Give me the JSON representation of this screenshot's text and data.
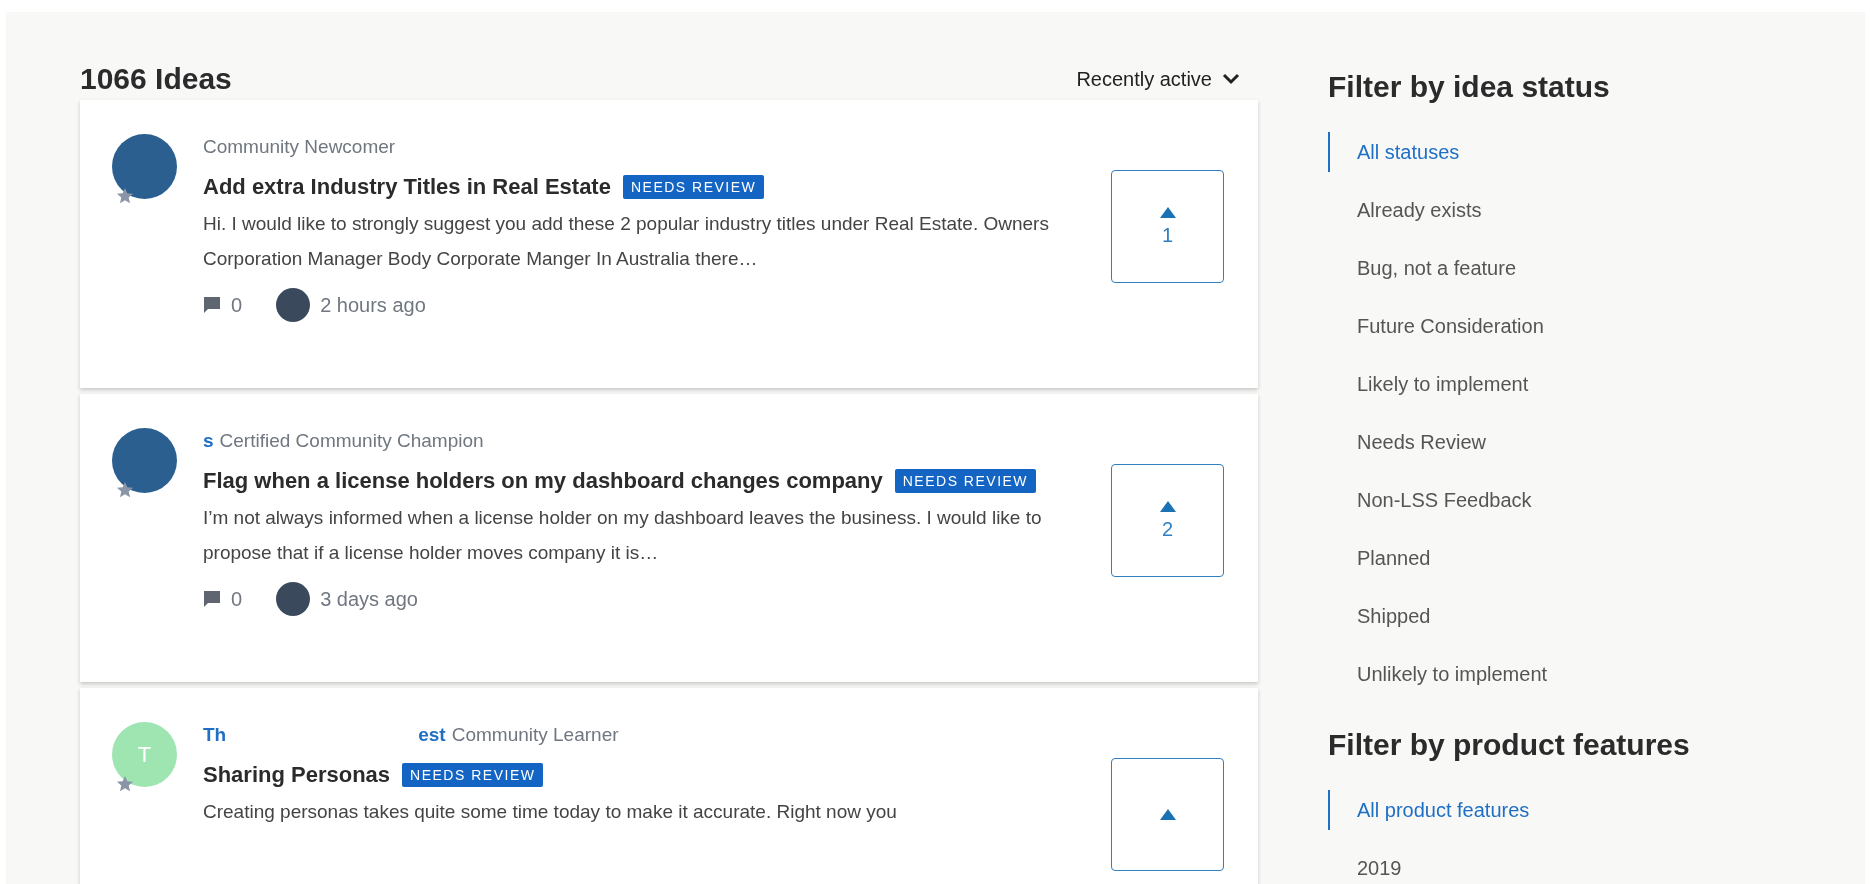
{
  "header": {
    "title": "1066 Ideas",
    "sort": {
      "label": "Recently active"
    }
  },
  "ideas": [
    {
      "avatar": {
        "kind": "photo"
      },
      "author_rank": "Community Newcomer",
      "title": "Add extra Industry Titles in Real Estate",
      "status": "NEEDS REVIEW",
      "excerpt": "Hi. I would like to strongly suggest you add these 2 popular industry titles under Real Estate. Owners Corporation Manager Body Corporate Manger In Australia there…",
      "comments": "0",
      "time": "2 hours ago",
      "votes": "1"
    },
    {
      "avatar": {
        "kind": "photo"
      },
      "author_name_parts": [
        "s"
      ],
      "author_rank": "Certified Community Champion",
      "title": "Flag when a license holders on my dashboard changes company",
      "status": "NEEDS REVIEW",
      "excerpt": "I’m not always informed when a license holder on my dashboard leaves the business. I would like to propose that if a license holder moves company it is…",
      "comments": "0",
      "time": "3 days ago",
      "votes": "2"
    },
    {
      "avatar": {
        "kind": "initial",
        "letter": "T"
      },
      "author_name_parts": [
        "Th",
        "est"
      ],
      "author_rank": "Community Learner",
      "title": "Sharing Personas",
      "status": "NEEDS REVIEW",
      "excerpt": "Creating personas takes quite some time today to make it accurate. Right now you"
    }
  ],
  "sidebar": {
    "sections": [
      {
        "heading": "Filter by idea status",
        "items": [
          {
            "label": "All statuses",
            "selected": true
          },
          {
            "label": "Already exists",
            "selected": false
          },
          {
            "label": "Bug, not a feature",
            "selected": false
          },
          {
            "label": "Future Consideration",
            "selected": false
          },
          {
            "label": "Likely to implement",
            "selected": false
          },
          {
            "label": "Needs Review",
            "selected": false
          },
          {
            "label": "Non-LSS Feedback",
            "selected": false
          },
          {
            "label": "Planned",
            "selected": false
          },
          {
            "label": "Shipped",
            "selected": false
          },
          {
            "label": "Unlikely to implement",
            "selected": false
          }
        ]
      },
      {
        "heading": "Filter by product features",
        "items": [
          {
            "label": "All product features",
            "selected": true
          },
          {
            "label": "2019",
            "selected": false
          }
        ]
      }
    ]
  }
}
